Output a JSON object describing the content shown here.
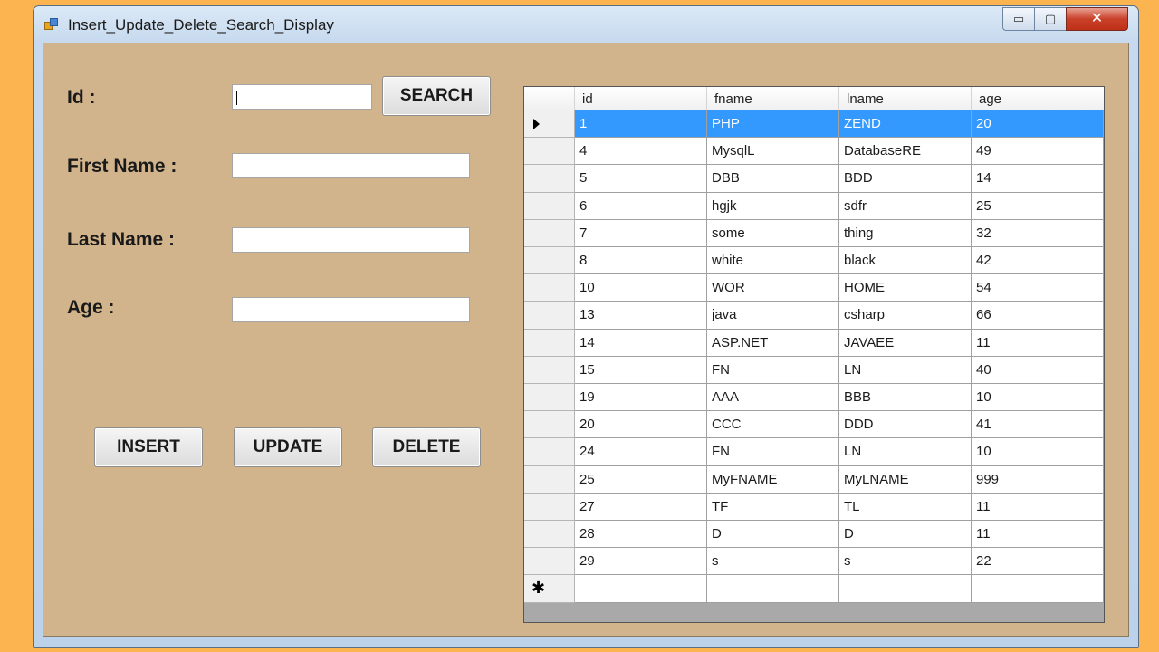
{
  "window": {
    "title": "Insert_Update_Delete_Search_Display",
    "icon": "app-icon"
  },
  "controls": {
    "minimize": "▭",
    "maximize": "▢",
    "close": "✕"
  },
  "form": {
    "id_label": "Id :",
    "fname_label": "First Name :",
    "lname_label": "Last Name :",
    "age_label": "Age :",
    "id_value": "",
    "fname_value": "",
    "lname_value": "",
    "age_value": "",
    "search_label": "SEARCH",
    "insert_label": "INSERT",
    "update_label": "UPDATE",
    "delete_label": "DELETE"
  },
  "grid": {
    "columns": [
      "id",
      "fname",
      "lname",
      "age"
    ],
    "selected_row": 0,
    "new_row_marker": "✱",
    "rows": [
      [
        "1",
        "PHP",
        "ZEND",
        "20"
      ],
      [
        "4",
        "MysqlL",
        "DatabaseRE",
        "49"
      ],
      [
        "5",
        "DBB",
        "BDD",
        "14"
      ],
      [
        "6",
        "hgjk",
        "sdfr",
        "25"
      ],
      [
        "7",
        "some",
        "thing",
        "32"
      ],
      [
        "8",
        "white",
        "black",
        "42"
      ],
      [
        "10",
        "WOR",
        "HOME",
        "54"
      ],
      [
        "13",
        "java",
        "csharp",
        "66"
      ],
      [
        "14",
        "ASP.NET",
        "JAVAEE",
        "11"
      ],
      [
        "15",
        "FN",
        "LN",
        "40"
      ],
      [
        "19",
        "AAA",
        "BBB",
        "10"
      ],
      [
        "20",
        "CCC",
        "DDD",
        "41"
      ],
      [
        "24",
        "FN",
        "LN",
        "10"
      ],
      [
        "25",
        "MyFNAME",
        "MyLNAME",
        "999"
      ],
      [
        "27",
        "TF",
        "TL",
        "11"
      ],
      [
        "28",
        "D",
        "D",
        "11"
      ],
      [
        "29",
        "s",
        "s",
        "22"
      ]
    ]
  },
  "colors": {
    "form_bg": "#d2b48c",
    "desktop_bg": "#fbb450",
    "selection": "#3399ff"
  }
}
